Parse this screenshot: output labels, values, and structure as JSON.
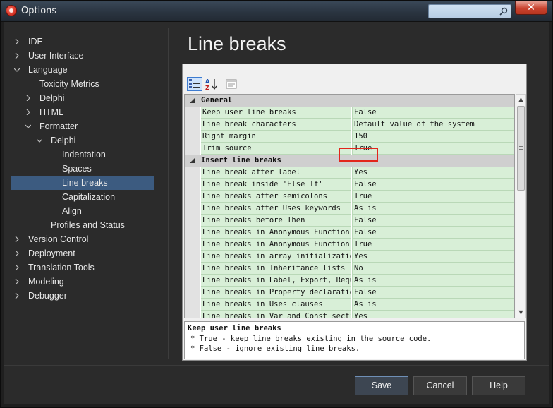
{
  "window": {
    "title": "Options",
    "search_placeholder": ""
  },
  "tree": [
    {
      "label": "IDE",
      "arrow": "right",
      "indent": 0
    },
    {
      "label": "User Interface",
      "arrow": "right",
      "indent": 0
    },
    {
      "label": "Language",
      "arrow": "down",
      "indent": 0
    },
    {
      "label": "Toxicity Metrics",
      "arrow": "none",
      "indent": 1
    },
    {
      "label": "Delphi",
      "arrow": "right",
      "indent": 1
    },
    {
      "label": "HTML",
      "arrow": "right",
      "indent": 1
    },
    {
      "label": "Formatter",
      "arrow": "down",
      "indent": 1
    },
    {
      "label": "Delphi",
      "arrow": "down",
      "indent": 2
    },
    {
      "label": "Indentation",
      "arrow": "none",
      "indent": 3
    },
    {
      "label": "Spaces",
      "arrow": "none",
      "indent": 3
    },
    {
      "label": "Line breaks",
      "arrow": "none",
      "indent": 3,
      "selected": true
    },
    {
      "label": "Capitalization",
      "arrow": "none",
      "indent": 3
    },
    {
      "label": "Align",
      "arrow": "none",
      "indent": 3
    },
    {
      "label": "Profiles and Status",
      "arrow": "none",
      "indent": 2
    },
    {
      "label": "Version Control",
      "arrow": "right",
      "indent": 0
    },
    {
      "label": "Deployment",
      "arrow": "right",
      "indent": 0
    },
    {
      "label": "Translation Tools",
      "arrow": "right",
      "indent": 0
    },
    {
      "label": "Modeling",
      "arrow": "right",
      "indent": 0
    },
    {
      "label": "Debugger",
      "arrow": "right",
      "indent": 0
    }
  ],
  "page": {
    "title": "Line breaks"
  },
  "inspector": {
    "rows": [
      {
        "type": "category",
        "name": "General"
      },
      {
        "type": "prop",
        "name": "Keep user line breaks",
        "value": "False"
      },
      {
        "type": "prop",
        "name": "Line break characters",
        "value": "Default value of the system"
      },
      {
        "type": "prop",
        "name": "Right margin",
        "value": "150"
      },
      {
        "type": "prop",
        "name": "Trim source",
        "value": "True"
      },
      {
        "type": "category",
        "name": "Insert line breaks"
      },
      {
        "type": "prop",
        "name": "Line break after label",
        "value": "Yes"
      },
      {
        "type": "prop",
        "name": "Line break inside 'Else If'",
        "value": "False"
      },
      {
        "type": "prop",
        "name": "Line breaks after semicolons",
        "value": "True"
      },
      {
        "type": "prop",
        "name": "Line breaks after Uses keywords",
        "value": "As is"
      },
      {
        "type": "prop",
        "name": "Line breaks before Then",
        "value": "False"
      },
      {
        "type": "prop",
        "name": "Line breaks in Anonymous Function a",
        "value": "False"
      },
      {
        "type": "prop",
        "name": "Line breaks in Anonymous Function u",
        "value": "True"
      },
      {
        "type": "prop",
        "name": "Line breaks in array initialization",
        "value": "Yes"
      },
      {
        "type": "prop",
        "name": "Line breaks in Inheritance lists",
        "value": "No"
      },
      {
        "type": "prop",
        "name": "Line breaks in Label, Export, Requi",
        "value": "As is"
      },
      {
        "type": "prop",
        "name": "Line breaks in Property declaration",
        "value": "False"
      },
      {
        "type": "prop",
        "name": "Line breaks in Uses clauses",
        "value": "As is"
      },
      {
        "type": "prop",
        "name": "Line breaks in Var and Const sectio",
        "value": "Yes"
      }
    ],
    "description": {
      "title": "Keep user line breaks",
      "lines": [
        "* True - keep line breaks existing in the source code.",
        "* False - ignore existing line breaks."
      ]
    }
  },
  "footer": {
    "save_label": "Save",
    "cancel_label": "Cancel",
    "help_label": "Help"
  },
  "colors": {
    "selection": "#3c5b80",
    "grid_cell": "#d8efd7",
    "highlight_box": "#e2261c"
  }
}
